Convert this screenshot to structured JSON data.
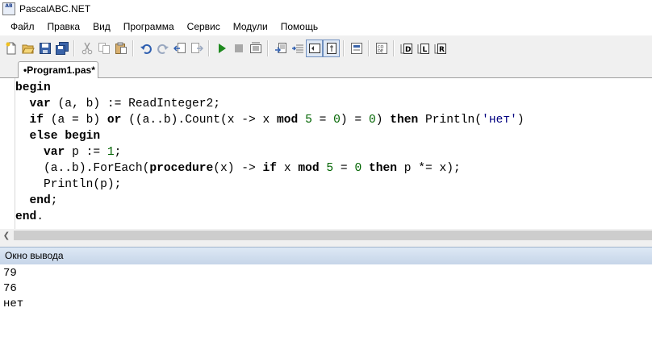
{
  "window": {
    "title": "PascalABC.NET",
    "icon": "pascal-app-icon",
    "icon_text": "AB"
  },
  "menu": [
    "Файл",
    "Правка",
    "Вид",
    "Программа",
    "Сервис",
    "Модули",
    "Помощь"
  ],
  "toolbar": {
    "buttons": [
      "new-file-icon",
      "open-icon",
      "save-icon",
      "save-all-icon",
      "cut-icon",
      "copy-icon",
      "paste-icon",
      "undo-icon",
      "redo-icon",
      "nav-back-icon",
      "nav-forward-icon",
      "run-icon",
      "stop-icon",
      "compile-icon",
      "step-into-icon",
      "step-over-icon",
      "debug-toggle-icon",
      "watch-toggle-icon",
      "form-designer-icon",
      "code-template-icon",
      "desc-d-icon",
      "desc-l-icon",
      "desc-r-icon"
    ],
    "colors": {
      "run": "#1f8a1f",
      "accent": "#3a63a8"
    }
  },
  "tab": {
    "label": "•Program1.pas*"
  },
  "editor": {
    "lines": [
      "begin",
      "  var (a, b) := ReadInteger2;",
      "  if (a = b) or ((a..b).Count(x -> x mod 5 = 0) = 0) then Println('нет')",
      "  else begin",
      "    var p := 1;",
      "    (a..b).ForEach(procedure(x) -> if x mod 5 = 0 then p *= x);",
      "    Println(p);",
      "  end;",
      "end."
    ]
  },
  "output": {
    "header": "Окно вывода",
    "lines": [
      "79",
      "76",
      "нет"
    ]
  }
}
